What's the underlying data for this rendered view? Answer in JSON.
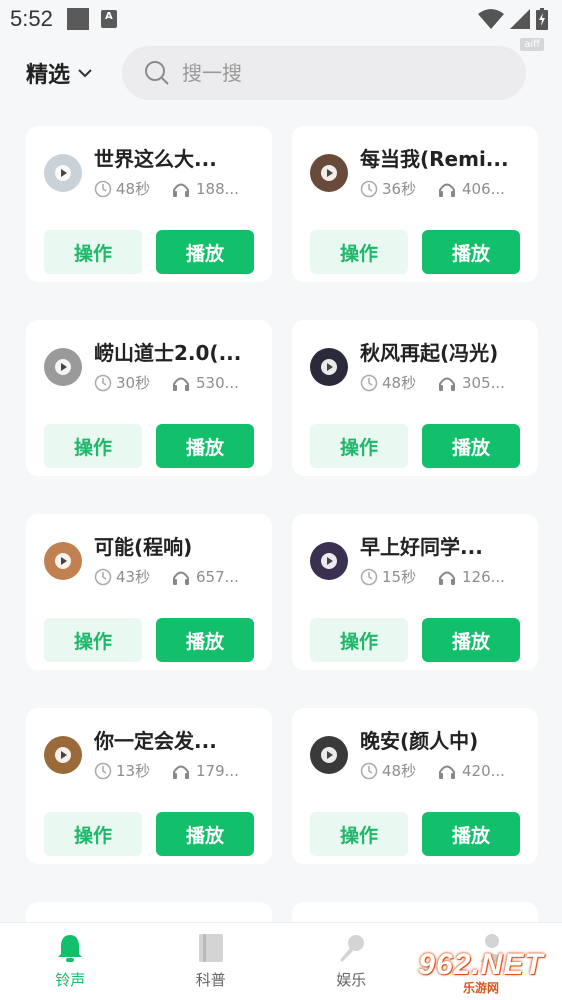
{
  "status_bar": {
    "time": "5:52",
    "a_icon": "A"
  },
  "badge": "aiff",
  "header": {
    "select_label": "精选",
    "search_placeholder": "搜一搜"
  },
  "cards": [
    {
      "title": "世界这么大...",
      "duration": "48秒",
      "plays": "188...",
      "op_label": "操作",
      "play_label": "播放",
      "thumb_color": "#c9d2d8"
    },
    {
      "title": "每当我(Remi...",
      "duration": "36秒",
      "plays": "406...",
      "op_label": "操作",
      "play_label": "播放",
      "thumb_color": "#6a4a3a"
    },
    {
      "title": "崂山道士2.0(...",
      "duration": "30秒",
      "plays": "530...",
      "op_label": "操作",
      "play_label": "播放",
      "thumb_color": "#9a9a9a"
    },
    {
      "title": "秋风再起(冯光)",
      "duration": "48秒",
      "plays": "305...",
      "op_label": "操作",
      "play_label": "播放",
      "thumb_color": "#2a2a3a"
    },
    {
      "title": "可能(程响)",
      "duration": "43秒",
      "plays": "657...",
      "op_label": "操作",
      "play_label": "播放",
      "thumb_color": "#c08050"
    },
    {
      "title": "早上好同学...",
      "duration": "15秒",
      "plays": "126...",
      "op_label": "操作",
      "play_label": "播放",
      "thumb_color": "#3a3050"
    },
    {
      "title": "你一定会发...",
      "duration": "13秒",
      "plays": "179...",
      "op_label": "操作",
      "play_label": "播放",
      "thumb_color": "#9a6a3a"
    },
    {
      "title": "晚安(颜人中)",
      "duration": "48秒",
      "plays": "420...",
      "op_label": "操作",
      "play_label": "播放",
      "thumb_color": "#3a3a3a"
    }
  ],
  "bottom_nav": [
    {
      "label": "铃声",
      "icon": "bell-icon",
      "active": true
    },
    {
      "label": "科普",
      "icon": "book-icon",
      "active": false
    },
    {
      "label": "娱乐",
      "icon": "microphone-icon",
      "active": false
    },
    {
      "label": "",
      "icon": "user-icon",
      "active": false
    }
  ],
  "watermark": {
    "main": "962.NET",
    "sub": "乐游网"
  },
  "colors": {
    "accent": "#12c06b",
    "accent_light": "#e9f8f0",
    "bg": "#f6f7f9"
  }
}
